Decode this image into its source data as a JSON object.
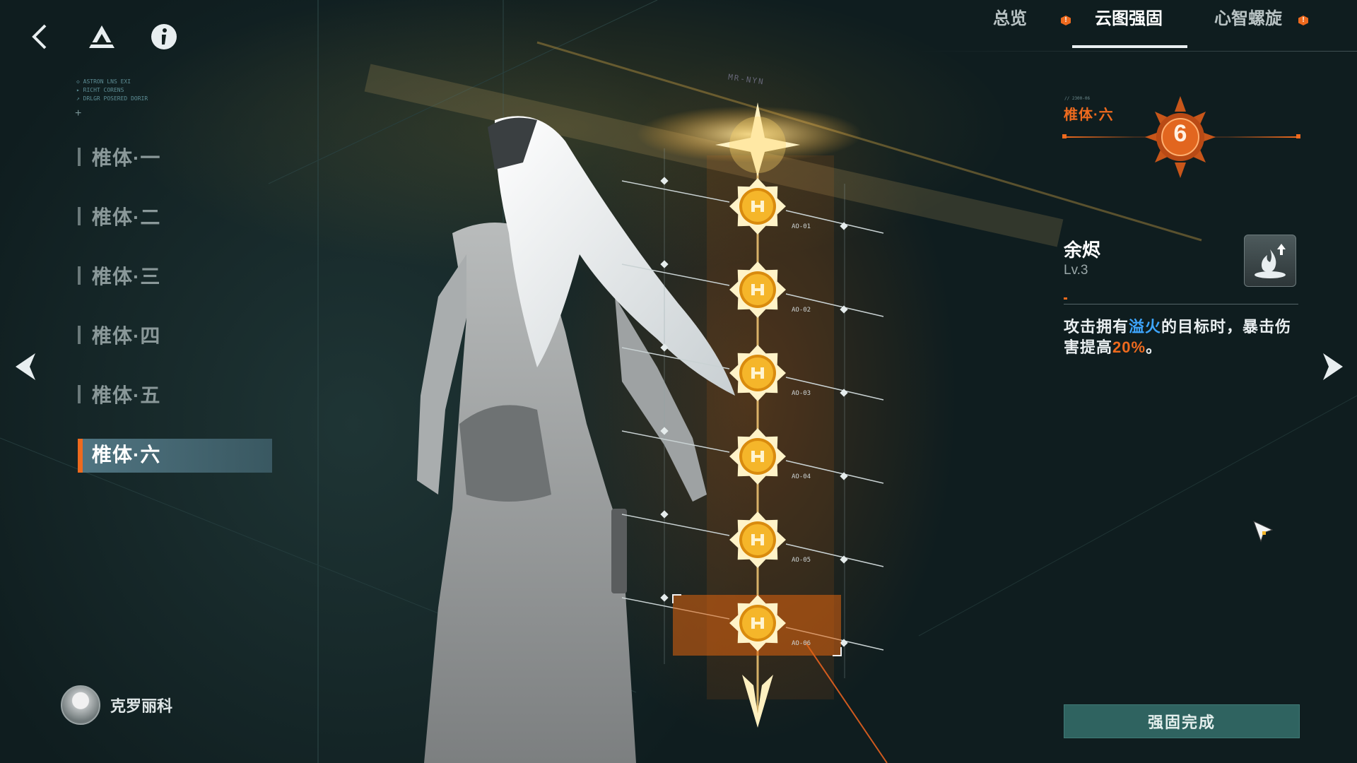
{
  "header": {
    "back_icon": "back-icon",
    "logo_icon": "triangle-logo-icon",
    "info_icon": "info-icon"
  },
  "tiny_caption": [
    "◇ ASTRON LNS EXI",
    "▸ RICHT CORENS",
    "↗ DRLGR POSERED DORIR"
  ],
  "top_code": "MR-NYN",
  "nav": {
    "items": [
      {
        "label": "椎体·一"
      },
      {
        "label": "椎体·二"
      },
      {
        "label": "椎体·三"
      },
      {
        "label": "椎体·四"
      },
      {
        "label": "椎体·五"
      },
      {
        "label": "椎体·六",
        "active": true
      }
    ]
  },
  "character": {
    "name": "克罗丽科"
  },
  "tabs": [
    {
      "label": "总览",
      "badge": "!"
    },
    {
      "label": "云图强固",
      "active": true
    },
    {
      "label": "心智螺旋",
      "badge": "!"
    }
  ],
  "nodes": [
    {
      "code": "AO-01"
    },
    {
      "code": "AO-02"
    },
    {
      "code": "AO-03"
    },
    {
      "code": "AO-04"
    },
    {
      "code": "AO-05"
    },
    {
      "code": "AO-06",
      "selected": true
    }
  ],
  "rank": {
    "title": "椎体·六",
    "number": "6",
    "small_caption": "// 2300-06"
  },
  "skill": {
    "name": "余烬",
    "level": "Lv.3",
    "desc_prefix": "攻击拥有",
    "desc_keyword": "溢火",
    "desc_middle": "的目标时，暴击伤害提高",
    "desc_percent": "20%",
    "desc_suffix": "。",
    "icon": "flame-upgrade-icon"
  },
  "confirm_button": "强固完成",
  "colors": {
    "accent": "#ee6a1e",
    "keyword": "#3ea6ff",
    "button": "#2f6360",
    "node_gold": "#f5b62a"
  }
}
